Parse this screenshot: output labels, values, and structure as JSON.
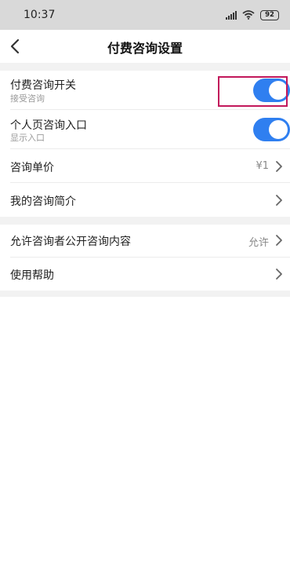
{
  "status_bar": {
    "time": "10:37",
    "battery": "92"
  },
  "header": {
    "title": "付费咨询设置"
  },
  "settings": {
    "paid_consult": {
      "label": "付费咨询开关",
      "sub": "接受咨询",
      "enabled": true
    },
    "profile_entry": {
      "label": "个人页咨询入口",
      "sub": "显示入口",
      "enabled": true
    },
    "unit_price": {
      "label": "咨询单价",
      "value": "¥1"
    },
    "intro": {
      "label": "我的咨询简介"
    },
    "public_content": {
      "label": "允许咨询者公开咨询内容",
      "value": "允许"
    },
    "help": {
      "label": "使用帮助"
    }
  },
  "colors": {
    "toggle_on": "#2f7ff0",
    "highlight": "#c2185b",
    "section_gap": "#f2f2f2"
  },
  "icons": [
    "wifi-icon",
    "signal-icon",
    "battery-icon",
    "back-arrow-icon",
    "chevron-right-icon"
  ]
}
